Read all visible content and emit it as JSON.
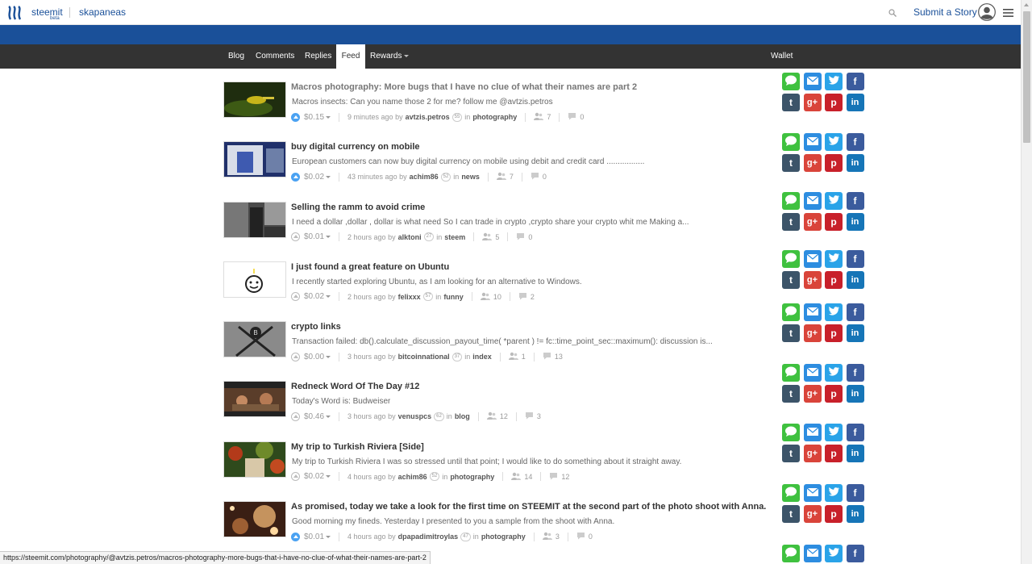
{
  "header": {
    "brand": "steemit",
    "brand_beta": "beta",
    "username": "skapaneas",
    "submit_label": "Submit a Story",
    "icons": {
      "search": "search-icon",
      "avatar": "user-avatar-icon",
      "menu": "hamburger-menu-icon"
    }
  },
  "nav": {
    "tabs": [
      "Blog",
      "Comments",
      "Replies",
      "Feed",
      "Rewards"
    ],
    "active": "Feed",
    "wallet": "Wallet"
  },
  "posts": [
    {
      "title": "Macros photography: More bugs that I have no clue of what their names are part 2",
      "body": "Macros insects:  Can you name those 2 for me?   follow me @avtzis.petros",
      "payout": "$0.15",
      "time": "9 minutes ago by",
      "author": "avtzis.petros",
      "rep": "55",
      "in": "in",
      "category": "photography",
      "voters": "7",
      "comments": "0",
      "voted": true,
      "visited": true
    },
    {
      "title": "buy digital currency on mobile",
      "body": "European customers can now buy digital currency on mobile using debit and credit card .................",
      "payout": "$0.02",
      "time": "43 minutes ago by",
      "author": "achim86",
      "rep": "52",
      "in": "in",
      "category": "news",
      "voters": "7",
      "comments": "0",
      "voted": true,
      "visited": false
    },
    {
      "title": "Selling the ramm to avoid crime",
      "body": "I need a dollar ,dollar , dollar is what need So I can trade in crypto ,crypto share your crypto whit me Making a...",
      "payout": "$0.01",
      "time": "2 hours ago by",
      "author": "alktoni",
      "rep": "27",
      "in": "in",
      "category": "steem",
      "voters": "5",
      "comments": "0",
      "voted": false,
      "visited": false
    },
    {
      "title": "I just found a great feature on Ubuntu",
      "body": "I recently started exploring Ubuntu, as I am looking for an alternative to Windows.",
      "payout": "$0.02",
      "time": "2 hours ago by",
      "author": "felixxx",
      "rep": "57",
      "in": "in",
      "category": "funny",
      "voters": "10",
      "comments": "2",
      "voted": false,
      "visited": false
    },
    {
      "title": "crypto links",
      "body": "Transaction failed: db().calculate_discussion_payout_time( *parent ) != fc::time_point_sec::maximum(): discussion is...",
      "payout": "$0.00",
      "time": "3 hours ago by",
      "author": "bitcoinnational",
      "rep": "37",
      "in": "in",
      "category": "index",
      "voters": "1",
      "comments": "13",
      "voted": false,
      "visited": false
    },
    {
      "title": "Redneck Word Of The Day #12",
      "body": "Today's Word is: Budweiser",
      "payout": "$0.46",
      "time": "3 hours ago by",
      "author": "venuspcs",
      "rep": "62",
      "in": "in",
      "category": "blog",
      "voters": "12",
      "comments": "3",
      "voted": false,
      "visited": false
    },
    {
      "title": "My trip to Turkish Riviera [Side]",
      "body": "My trip to Turkish Riviera I was so stressed until that point; I would like to do something about it straight away.",
      "payout": "$0.02",
      "time": "4 hours ago by",
      "author": "achim86",
      "rep": "52",
      "in": "in",
      "category": "photography",
      "voters": "14",
      "comments": "12",
      "voted": false,
      "visited": false
    },
    {
      "title": "As promised, today we take a look for the first time on STEEMIT at the second part of the photo shoot with Anna.",
      "body": "Good morning my fineds. Yesterday I presented to you a sample from the shoot with Anna.",
      "payout": "$0.01",
      "time": "4 hours ago by",
      "author": "dpapadimitroylas",
      "rep": "47",
      "in": "in",
      "category": "photography",
      "voters": "3",
      "comments": "0",
      "voted": true,
      "visited": false
    }
  ],
  "share_buttons": [
    {
      "name": "message",
      "color": "#3fc13f"
    },
    {
      "name": "email",
      "color": "#2d8de0"
    },
    {
      "name": "twitter",
      "color": "#2aa3e8"
    },
    {
      "name": "facebook",
      "color": "#3b5b9d"
    },
    {
      "name": "tumblr",
      "color": "#3c5469"
    },
    {
      "name": "googleplus",
      "color": "#d9443a"
    },
    {
      "name": "pinterest",
      "color": "#c8202a"
    },
    {
      "name": "linkedin",
      "color": "#1675b7"
    }
  ],
  "share_glyphs": {
    "tumblr": "t",
    "googleplus": "g+",
    "pinterest": "p",
    "linkedin": "in",
    "facebook": "f"
  },
  "status_url": "https://steemit.com/photography/@avtzis.petros/macros-photography-more-bugs-that-i-have-no-clue-of-what-their-names-are-part-2"
}
